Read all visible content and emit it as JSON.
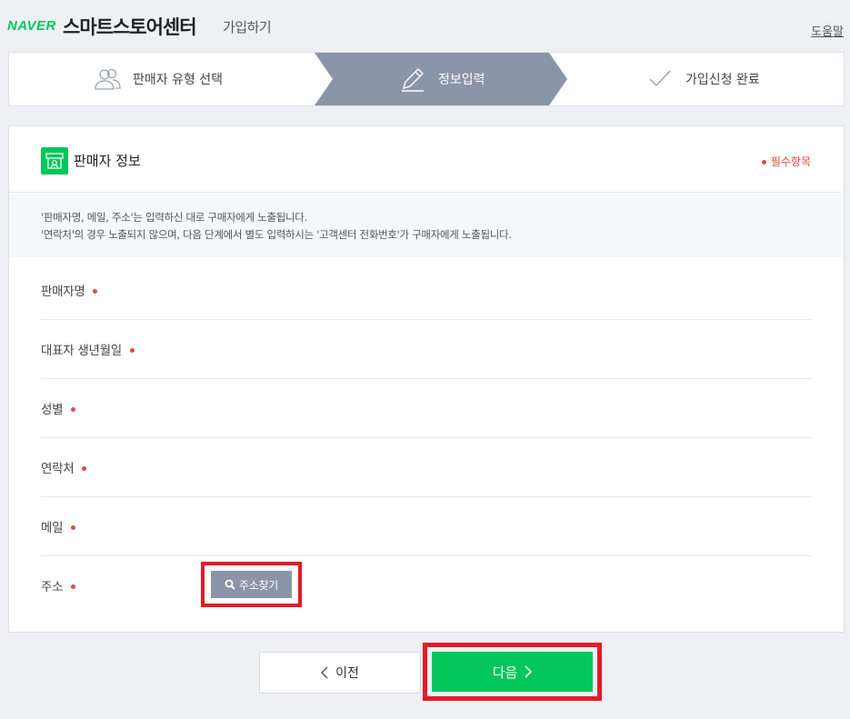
{
  "header": {
    "brand": "NAVER",
    "title": "스마트스토어센터",
    "subtitle": "가입하기",
    "help_link": "도움말"
  },
  "steps": [
    {
      "label": "판매자 유형 선택",
      "icon": "users-icon",
      "active": false
    },
    {
      "label": "정보입력",
      "icon": "pencil-icon",
      "active": true
    },
    {
      "label": "가입신청 완료",
      "icon": "check-icon",
      "active": false
    }
  ],
  "section": {
    "title": "판매자 정보",
    "icon": "store-icon",
    "required_legend": "필수항목",
    "notice_lines": [
      "'판매자명, 메일, 주소'는 입력하신 대로 구매자에게 노출됩니다.",
      "'연락처'의 경우 노출되지 않으며, 다음 단계에서 별도 입력하시는 '고객센터 전화번호'가 구매자에게 노출됩니다."
    ]
  },
  "fields": [
    {
      "label": "판매자명",
      "required": true
    },
    {
      "label": "대표자 생년월일",
      "required": true
    },
    {
      "label": "성별",
      "required": true
    },
    {
      "label": "연락처",
      "required": true
    },
    {
      "label": "메일",
      "required": true
    },
    {
      "label": "주소",
      "required": true
    }
  ],
  "address_search_button": "주소찾기",
  "nav": {
    "prev_label": "이전",
    "next_label": "다음"
  },
  "colors": {
    "brand_green": "#03c75a",
    "active_step": "#8b95a8",
    "required_red": "#e04a3f",
    "highlight_red": "#e21b27"
  }
}
